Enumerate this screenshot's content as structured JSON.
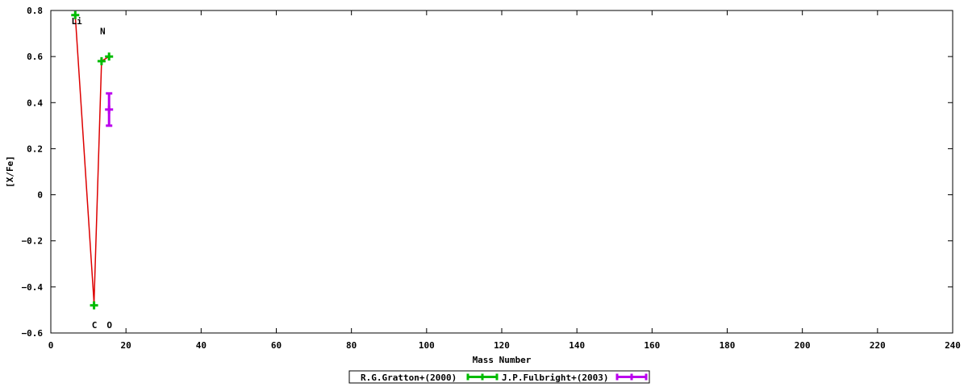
{
  "chart_data": {
    "type": "scatter",
    "xlabel": "Mass Number",
    "ylabel": "[X/Fe]",
    "xlim": [
      0,
      240
    ],
    "ylim": [
      -0.6,
      0.8
    ],
    "x_ticks": [
      0,
      20,
      40,
      60,
      80,
      100,
      120,
      140,
      160,
      180,
      200,
      220,
      240
    ],
    "y_ticks": [
      -0.6,
      -0.4,
      -0.2,
      0,
      0.2,
      0.4,
      0.6,
      0.8
    ],
    "y_tick_labels": [
      "−0.6",
      "−0.4",
      "−0.2",
      "0",
      "0.2",
      "0.4",
      "0.6",
      "0.8"
    ],
    "grid": false,
    "legend_placement": "bottom-center",
    "fit_line": {
      "color": "#dd0000",
      "points": [
        {
          "x": 6.5,
          "y": 0.78
        },
        {
          "x": 11.5,
          "y": -0.47
        },
        {
          "x": 13.5,
          "y": 0.58
        },
        {
          "x": 15.5,
          "y": 0.6
        }
      ]
    },
    "series": [
      {
        "name": "R.G.Gratton+(2000)",
        "color": "#00bb00",
        "points": [
          {
            "x": 6.5,
            "y": 0.78,
            "err": 0
          },
          {
            "x": 11.5,
            "y": -0.48,
            "err": 0
          },
          {
            "x": 13.5,
            "y": 0.58,
            "err": 0
          },
          {
            "x": 15.5,
            "y": 0.6,
            "err": 0
          }
        ]
      },
      {
        "name": "J.P.Fulbright+(2003)",
        "color": "#bb00ee",
        "points": [
          {
            "x": 15.5,
            "y": 0.37,
            "err": 0.07
          }
        ]
      }
    ],
    "annotations": [
      {
        "text": "Li",
        "x": 6.9,
        "y": 0.755
      },
      {
        "text": "N",
        "x": 13.8,
        "y": 0.71
      },
      {
        "text": "C",
        "x": 11.6,
        "y": -0.565
      },
      {
        "text": "O",
        "x": 15.6,
        "y": -0.565
      }
    ]
  }
}
